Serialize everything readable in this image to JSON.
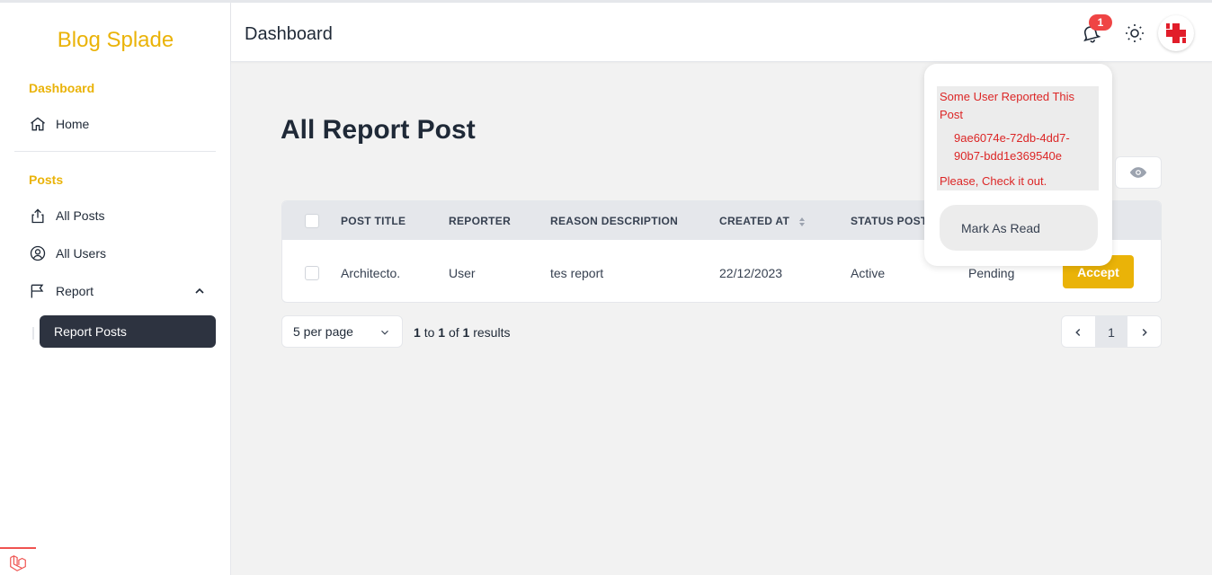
{
  "app": {
    "brand": "Blog Splade"
  },
  "header": {
    "title": "Dashboard",
    "notification_count": "1"
  },
  "sidebar": {
    "sections": [
      {
        "heading": "Dashboard",
        "items": [
          {
            "label": "Home",
            "icon": "home-icon"
          }
        ]
      },
      {
        "heading": "Posts",
        "items": [
          {
            "label": "All Posts",
            "icon": "share-icon"
          },
          {
            "label": "All Users",
            "icon": "user-circle-icon"
          },
          {
            "label": "Report",
            "icon": "flag-icon",
            "expanded": true
          }
        ]
      }
    ],
    "active_sub_item": "Report Posts"
  },
  "main": {
    "title": "All Report Post",
    "table": {
      "columns": [
        "POST TITLE",
        "REPORTER",
        "REASON DESCRIPTION",
        "CREATED AT",
        "STATUS POST"
      ],
      "rows": [
        {
          "post_title": "Architecto.",
          "reporter": "User",
          "reason": "tes report",
          "created_at": "22/12/2023",
          "status_post": "Active",
          "status": "Pending",
          "action": "Accept"
        }
      ]
    },
    "pagination": {
      "per_page": "5 per page",
      "from": "1",
      "to_word": "to",
      "to": "1",
      "of_word": "of",
      "total": "1",
      "results_word": "results",
      "current_page": "1"
    }
  },
  "notification": {
    "message": "Some User Reported This Post",
    "post_id": "9ae6074e-72db-4dd7-90b7-bdd1e369540e",
    "footer": "Please, Check it out.",
    "mark_read": "Mark As Read"
  },
  "colors": {
    "accent": "#eab308",
    "danger": "#ef4444",
    "active_nav": "#2d3340"
  }
}
